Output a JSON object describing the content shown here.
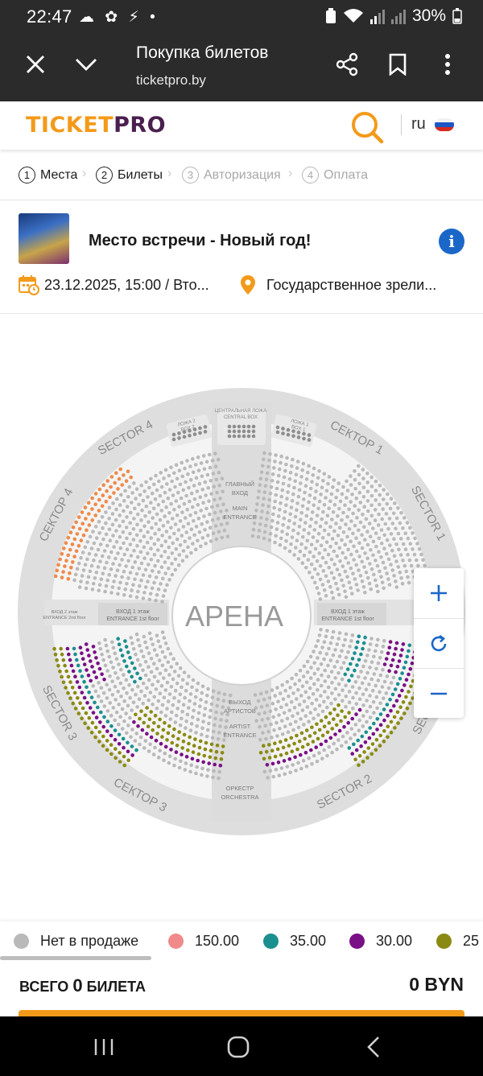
{
  "status_bar": {
    "time": "22:47",
    "icons": "☁ ✿ ⚡ •",
    "battery": "30%"
  },
  "browser": {
    "title": "Покупка билетов",
    "url": "ticketpro.by"
  },
  "site": {
    "logo_left": "TICKET",
    "logo_right": "PRO",
    "language": "ru",
    "flag_colors": [
      "#ffffff",
      "#1c57c4",
      "#d52b1e"
    ]
  },
  "steps": [
    {
      "num": "1",
      "label": "Места",
      "active": true
    },
    {
      "num": "2",
      "label": "Билеты",
      "active": true
    },
    {
      "num": "3",
      "label": "Авторизация",
      "active": false
    },
    {
      "num": "4",
      "label": "Оплата",
      "active": false
    }
  ],
  "event": {
    "name": "Место встречи - Новый год!",
    "datetime": "23.12.2025, 15:00 / Вто...",
    "venue": "Государственное зрели..."
  },
  "map": {
    "arena_label": "АРЕНА",
    "central_box": "ЦЕНТРАЛЬНАЯ ЛОЖА\nCENTRAL BOX",
    "box_left": "ЛОЖА 2\nBOX 2",
    "box_right": "ЛОЖА 1\nBOX 1",
    "main_entrance": "ГЛАВНЫЙ\nВХОД\n\nMAIN\nENTRANCE",
    "artist_entrance": "ВЫХОД\nАРТИСТОВ\n\nARTIST\nENTRANCE",
    "orchestra": "ОРКЕСТР\nORCHESTRA",
    "entrance_floor": "ВХОД 1 этаж\nENTRANCE 1st floor",
    "entrance_floor2": "ВХОД 2 этаж\nENTRANCE 2nd floor",
    "sector_labels": [
      "SECTOR 4",
      "СЕКТОР 1",
      "SECTOR 1",
      "СЕКТОР 4",
      "SECTOR 3",
      "СЕКТОР 3",
      "SECTOR 2",
      "SEC"
    ],
    "colors": {
      "unavailable": "#b9b9b9",
      "price_150": "#f08a8a",
      "price_35": "#1b8f8f",
      "price_30": "#7a0f86",
      "price_25": "#8a8a13",
      "orange_seats": "#ef8a4a"
    }
  },
  "zoom": {
    "plus": "+",
    "minus": "−"
  },
  "legend": [
    {
      "label": "Нет в продаже",
      "color": "#b9b9b9"
    },
    {
      "label": "150.00",
      "color": "#f08a8a"
    },
    {
      "label": "35.00",
      "color": "#1b8f8f"
    },
    {
      "label": "30.00",
      "color": "#7a0f86"
    },
    {
      "label": "25",
      "color": "#8a8a13"
    }
  ],
  "totals": {
    "prefix": "ВСЕГО",
    "count": "0",
    "suffix": "БИЛЕТА",
    "sum": "0 BYN"
  }
}
